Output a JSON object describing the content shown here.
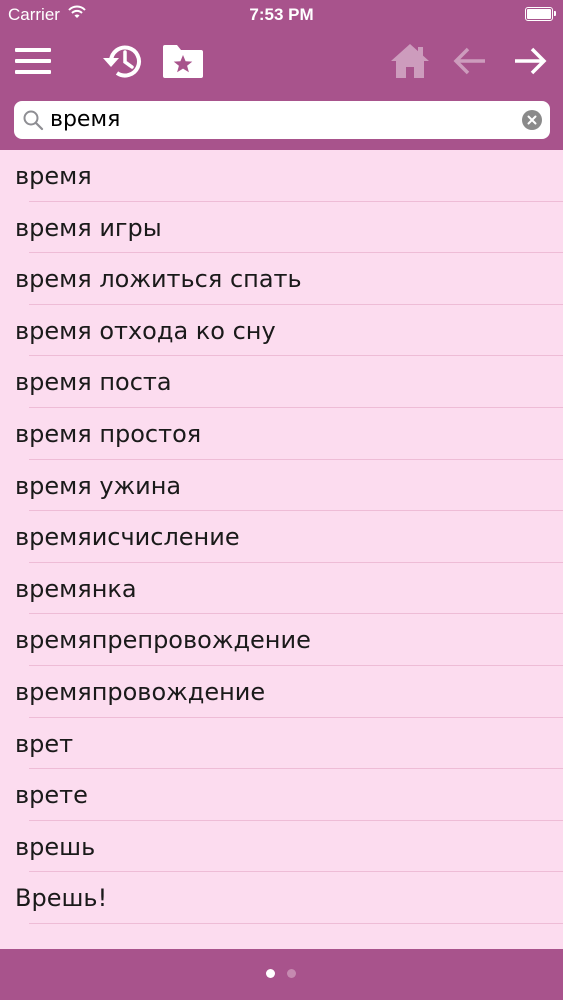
{
  "status_bar": {
    "carrier": "Carrier",
    "time": "7:53 PM"
  },
  "toolbar": {
    "icons": [
      "menu-icon",
      "history-icon",
      "favorites-folder-icon",
      "home-icon",
      "arrow-left-icon",
      "arrow-right-icon"
    ]
  },
  "search": {
    "value": "время"
  },
  "results": [
    "время",
    "время игры",
    "время ложиться спать",
    "время отхода ко сну",
    "время поста",
    "время простоя",
    "время ужина",
    "времяисчисление",
    "времянка",
    "времяпрепровождение",
    "времяпровождение",
    "врет",
    "врете",
    "врешь",
    "Врешь!"
  ],
  "pager": {
    "pages": 2,
    "current": 1
  },
  "colors": {
    "bar": "#a8538c",
    "list_background": "#fcdcef",
    "separator": "#eebcd6",
    "disabled_icon": "#cd9cbd"
  }
}
